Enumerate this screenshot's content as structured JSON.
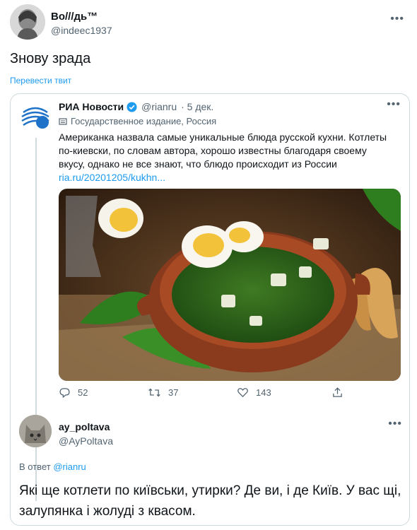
{
  "tweet": {
    "author_name": "Во///дь™",
    "author_handle": "@indeec1937",
    "text": "Знову зрада",
    "translate_label": "Перевести твит"
  },
  "quoted": {
    "name": "РИА Новости",
    "handle": "@rianru",
    "time": "· 5 дек.",
    "label": "Государственное издание, Россия",
    "text": "Американка назвала самые уникальные блюда русской кухни. Котлеты по-киевски, по словам автора, хорошо известны благодаря своему вкусу, однако не все знают, что блюдо происходит из России",
    "link": "ria.ru/20201205/kukhn...",
    "stats": {
      "replies": "52",
      "retweets": "37",
      "likes": "143"
    },
    "verified_color": "#1d9bf0"
  },
  "reply": {
    "name": "ay_poltava",
    "handle": "@AyPoltava",
    "reply_to_prefix": "В ответ",
    "reply_to_mention": "@rianru",
    "text": "Які ще котлети по київськи, утирки? Де ви, і де Київ. У вас щі, залупянка і жолуді з квасом."
  },
  "colors": {
    "accent": "#1d9bf0",
    "muted": "#536471",
    "border": "#cfd9de"
  }
}
